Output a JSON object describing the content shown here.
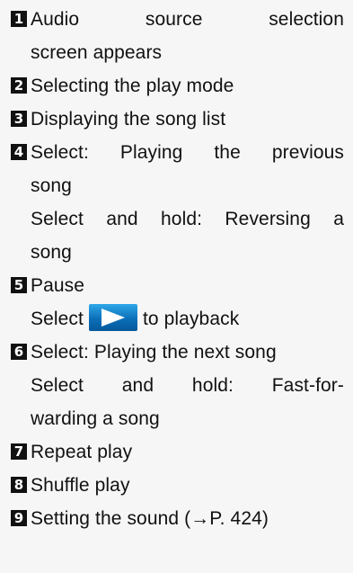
{
  "items": [
    {
      "num": "1",
      "line1": "Audio source selection",
      "line2": "screen appears"
    },
    {
      "num": "2",
      "line1": "Selecting the play mode"
    },
    {
      "num": "3",
      "line1": "Displaying the song list"
    },
    {
      "num": "4",
      "line1": "Select: Playing the previous",
      "line2": "song",
      "line3": "Select and hold: Reversing a",
      "line4": "song"
    },
    {
      "num": "5",
      "line1": "Pause",
      "line2_before": "Select",
      "line2_after": "to playback",
      "icon": "play-icon"
    },
    {
      "num": "6",
      "line1": "Select: Playing the next song",
      "line2": "Select and hold: Fast-for-",
      "line3": "warding a song"
    },
    {
      "num": "7",
      "line1": "Repeat play"
    },
    {
      "num": "8",
      "line1": "Shuffle play"
    },
    {
      "num": "9",
      "line1": "Setting the sound (→P. 424)"
    }
  ],
  "colors": {
    "background": "#f6f6f6",
    "badge": "#111111",
    "play_button_top": "#2ea8e8",
    "play_button_bottom": "#06589a"
  }
}
